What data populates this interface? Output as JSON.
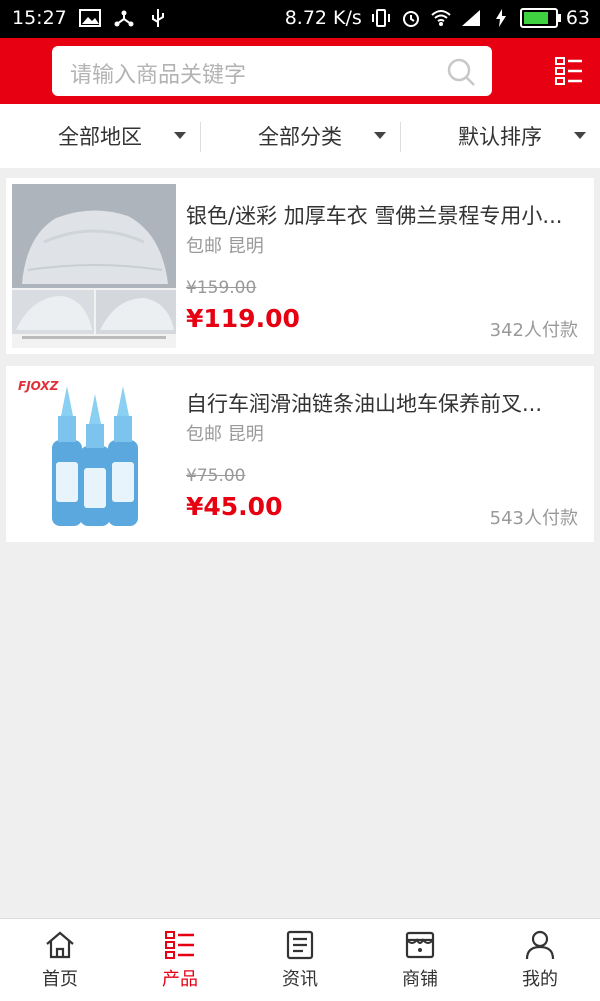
{
  "statusbar": {
    "time": "15:27",
    "net_speed": "8.72 K/s",
    "battery": "63"
  },
  "header": {
    "search_placeholder": "请输入商品关键字"
  },
  "filters": [
    {
      "label": "全部地区"
    },
    {
      "label": "全部分类"
    },
    {
      "label": "默认排序"
    }
  ],
  "products": [
    {
      "title": "银色/迷彩 加厚车衣 雪佛兰景程专用小...",
      "tags": "包邮 昆明",
      "old_price": "¥159.00",
      "price": "¥119.00",
      "sold": "342人付款",
      "image": "car-cover-photo"
    },
    {
      "title": "自行车润滑油链条油山地车保养前叉...",
      "tags": "包邮 昆明",
      "old_price": "¥75.00",
      "price": "¥45.00",
      "sold": "543人付款",
      "image": "chain-oil-bottles-photo",
      "brand": "FJOXZ"
    }
  ],
  "tabbar": [
    {
      "label": "首页",
      "icon": "home-icon"
    },
    {
      "label": "产品",
      "icon": "list-icon",
      "active": true
    },
    {
      "label": "资讯",
      "icon": "news-icon"
    },
    {
      "label": "商铺",
      "icon": "store-icon"
    },
    {
      "label": "我的",
      "icon": "user-icon"
    }
  ],
  "colors": {
    "accent": "#e60012",
    "background": "#efefef"
  }
}
